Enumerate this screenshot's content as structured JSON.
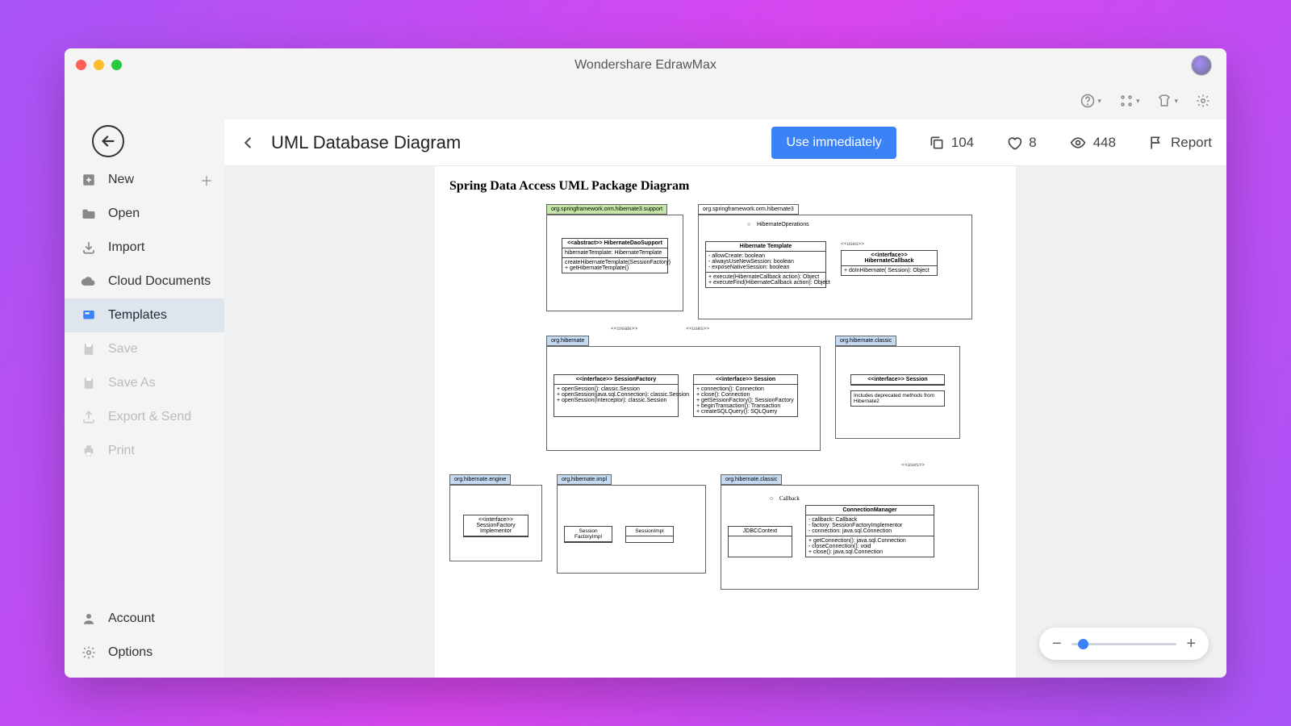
{
  "app_title": "Wondershare EdrawMax",
  "sidebar": {
    "items": [
      {
        "label": "New",
        "icon": "plus-square-icon",
        "disabled": false,
        "plus": true
      },
      {
        "label": "Open",
        "icon": "folder-icon",
        "disabled": false
      },
      {
        "label": "Import",
        "icon": "import-icon",
        "disabled": false
      },
      {
        "label": "Cloud Documents",
        "icon": "cloud-icon",
        "disabled": false
      },
      {
        "label": "Templates",
        "icon": "templates-icon",
        "disabled": false,
        "active": true
      },
      {
        "label": "Save",
        "icon": "save-icon",
        "disabled": true
      },
      {
        "label": "Save As",
        "icon": "save-as-icon",
        "disabled": true
      },
      {
        "label": "Export & Send",
        "icon": "export-icon",
        "disabled": true
      },
      {
        "label": "Print",
        "icon": "print-icon",
        "disabled": true
      }
    ],
    "footer": [
      {
        "label": "Account",
        "icon": "account-icon"
      },
      {
        "label": "Options",
        "icon": "gear-icon"
      }
    ]
  },
  "header": {
    "title": "UML Database Diagram",
    "use_btn": "Use immediately",
    "copies": "104",
    "likes": "8",
    "views": "448",
    "report": "Report"
  },
  "diagram": {
    "title": "Spring Data Access UML Package Diagram",
    "pkg1": {
      "tab": "org.springframework.orm.hibernate3.support",
      "cls_head": "<<abstract>> HibernateDaoSupport",
      "cls_l1": "hibernateTemplate: HibernateTemplate",
      "cls_l2": "createHibernateTemplate(SessionFactory)",
      "cls_l3": "+ getHibernateTemplate()"
    },
    "pkg2": {
      "tab": "org.springframework.orm.hibernate3",
      "op_label": "HibernateOperations",
      "tmpl_head": "Hibernate Template",
      "tmpl_l1": "- allowCreate: boolean",
      "tmpl_l2": "- alwaysUseNewSession: boolean",
      "tmpl_l3": "- exposeNativeSession: boolean",
      "tmpl_l4": "+ execute(HibernateCallback action): Object",
      "tmpl_l5": "+ executeFind(HibernateCallback action): Object",
      "ifc_head": "<<interface>>",
      "ifc_name": "HibernateCallback",
      "ifc_l1": "+ doInHibernate( Session): Object",
      "uses": "<<uses>>"
    },
    "pkg3": {
      "tab": "org.hibernate",
      "sf_head": "<<interface>> SessionFactory",
      "sf_l1": "+ openSession(): classic.Session",
      "sf_l2": "+ openSession(java.sql.Connection): classic.Session",
      "sf_l3": "+ openSession(Interceptor): classic.Session",
      "ses_head": "<<interface>> Session",
      "ses_l1": "+ connection(): Connection",
      "ses_l2": "+ close(): Connection",
      "ses_l3": "+ getSessionFactory(): SessionFactory",
      "ses_l4": "+ beginTransaction(): Transaction",
      "ses_l5": "+ createSQLQuery(): SQLQuery"
    },
    "pkg4": {
      "tab": "org.hibernate.classic",
      "cs_head": "<<interface>> Session",
      "note": "Includes deprecated methods from Hibernate2"
    },
    "pkg5": {
      "tab": "org.hibernate.engine",
      "cls_head": "<<interface>> SessionFactory Implementor"
    },
    "pkg6": {
      "tab": "org.hibernate.impl",
      "c1": "Session FactoryImpl",
      "c2": "SessionImpl"
    },
    "pkg7": {
      "tab": "org.hibernate.classic",
      "cb": "Callback",
      "jdbc": "JDBCContext",
      "cm_head": "ConnectionManager",
      "cm_l1": "- callback: Callback",
      "cm_l2": "- factory: SessionFactoryImplementor",
      "cm_l3": "- connection: java.sql.Connection",
      "cm_l4": "+ getConnection(): java.sql.Connection",
      "cm_l5": "- closeConnection(): void",
      "cm_l6": "+ close(): java.sql.Connection"
    },
    "labels": {
      "create": "<<create>>",
      "uses": "<<uses>>"
    }
  }
}
